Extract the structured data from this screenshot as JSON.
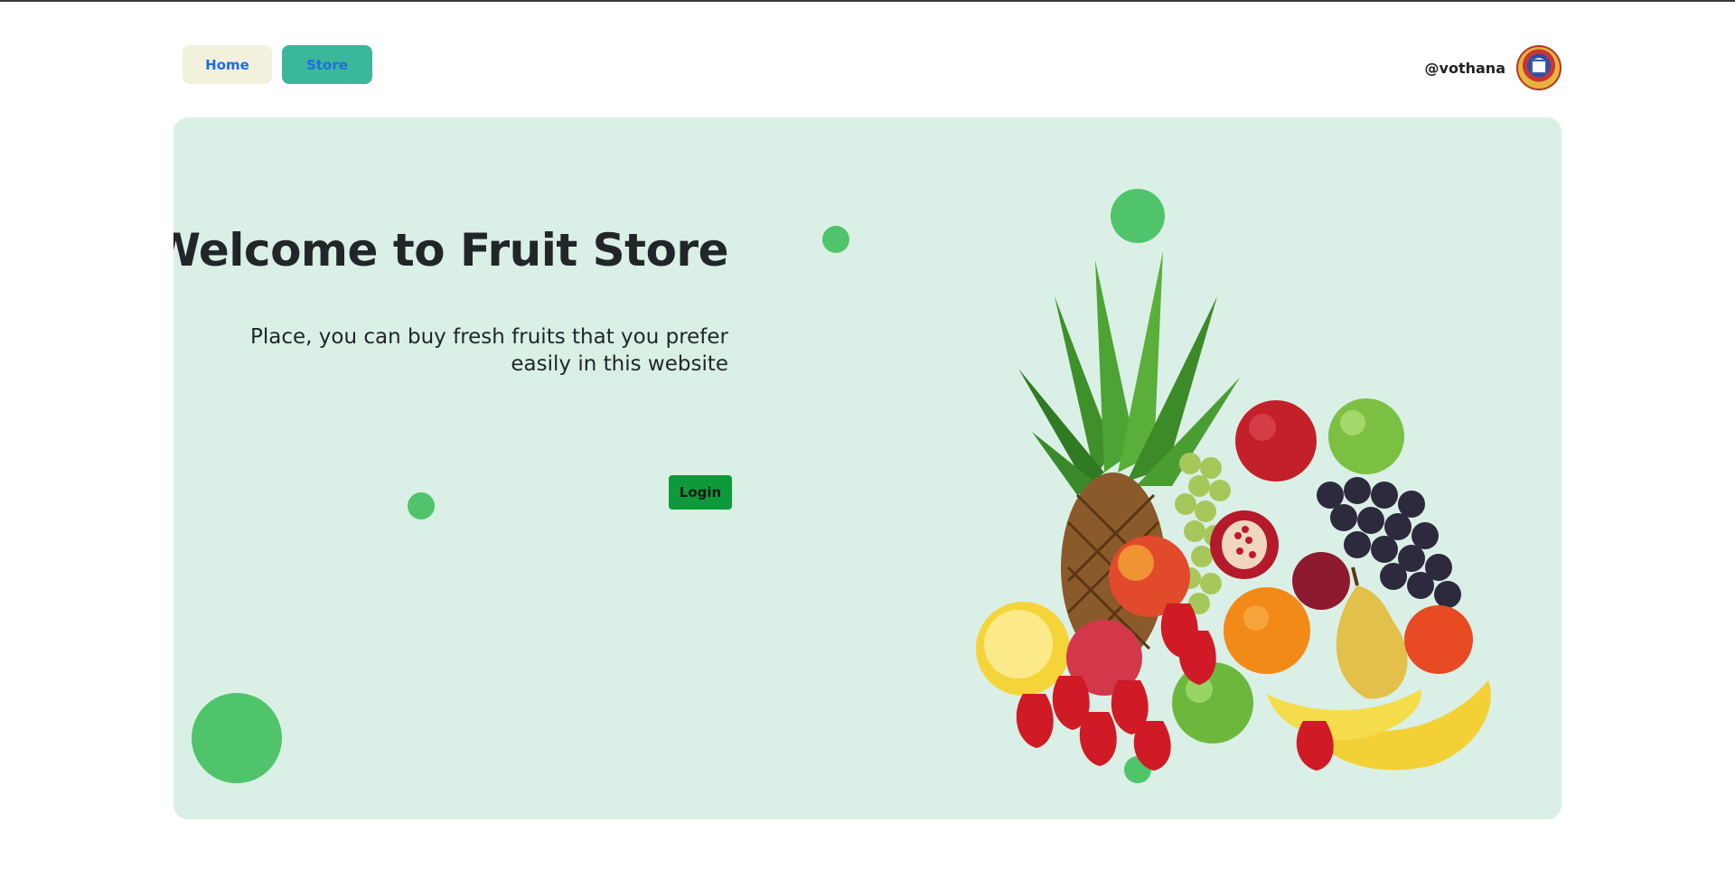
{
  "nav": {
    "home_label": "Home",
    "store_label": "Store"
  },
  "user": {
    "username": "@vothana",
    "avatar_icon": "emblem-avatar"
  },
  "hero": {
    "title": "Welcome to Fruit Store",
    "subtitle": "Place, you can buy fresh fruits that you prefer easily in this website",
    "login_label": "Login",
    "image": "fruit-basket-illustration"
  },
  "colors": {
    "hero_background": "#daf0e6",
    "accent_green": "#4fc46a",
    "login_button": "#0e9a3a",
    "store_button": "#3bb79b",
    "home_button": "#f2f1dc",
    "nav_text": "#1f6fe0"
  }
}
